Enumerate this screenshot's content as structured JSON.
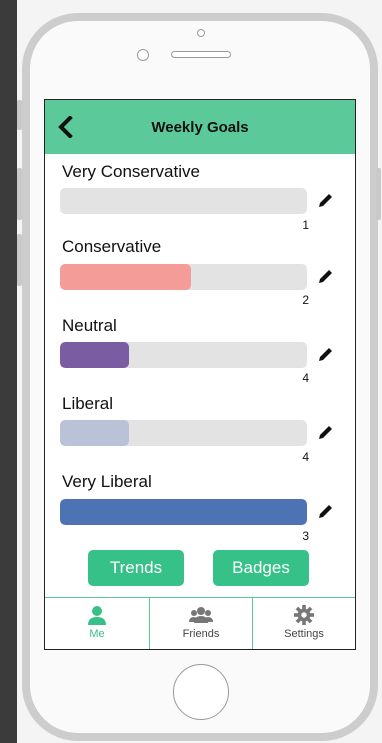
{
  "header": {
    "title": "Weekly Goals",
    "back_icon": "chevron-left-icon"
  },
  "goals": [
    {
      "label": "Very Conservative",
      "count": "1",
      "fill_fraction": 0.0,
      "color": "#e6e6e6"
    },
    {
      "label": "Conservative",
      "count": "2",
      "fill_fraction": 0.53,
      "color": "#f49c98"
    },
    {
      "label": "Neutral",
      "count": "4",
      "fill_fraction": 0.28,
      "color": "#7a5ca3"
    },
    {
      "label": "Liberal",
      "count": "4",
      "fill_fraction": 0.28,
      "color": "#b9c2d6"
    },
    {
      "label": "Very Liberal",
      "count": "3",
      "fill_fraction": 1.0,
      "color": "#4e73b4"
    }
  ],
  "buttons": {
    "trends": "Trends",
    "badges": "Badges"
  },
  "tabs": [
    {
      "label": "Me",
      "icon": "person-icon",
      "active": true
    },
    {
      "label": "Friends",
      "icon": "group-icon",
      "active": false
    },
    {
      "label": "Settings",
      "icon": "gear-icon",
      "active": false
    }
  ],
  "colors": {
    "accent": "#5cc99a",
    "button": "#35c187",
    "active_tab": "#35c187"
  }
}
